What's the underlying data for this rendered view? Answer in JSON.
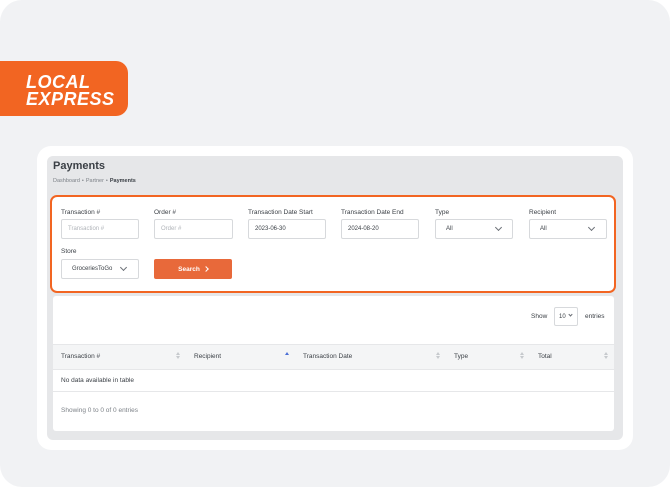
{
  "brand": {
    "logo_line1": "LOCAL",
    "logo_line2": "EXPRESS",
    "accent": "#f26522"
  },
  "page": {
    "title": "Payments",
    "breadcrumb": [
      "Dashboard",
      "Partner",
      "Payments"
    ],
    "separator": "•"
  },
  "filters": {
    "transaction": {
      "label": "Transaction #",
      "placeholder": "Transaction #",
      "value": ""
    },
    "order": {
      "label": "Order #",
      "placeholder": "Order #",
      "value": ""
    },
    "date_start": {
      "label": "Transaction Date Start",
      "value": "2023-06-30"
    },
    "date_end": {
      "label": "Transaction Date End",
      "value": "2024-08-20"
    },
    "type": {
      "label": "Type",
      "value": "All"
    },
    "recipient": {
      "label": "Recipient",
      "value": "All"
    },
    "store": {
      "label": "Store",
      "value": "GroceriesToGo"
    },
    "search_label": "Search"
  },
  "table": {
    "show_label": "Show",
    "page_size": "10",
    "entries_label": "entries",
    "columns": [
      "Transaction #",
      "Recipient",
      "Transaction Date",
      "Type",
      "Total"
    ],
    "empty_message": "No data available in table",
    "info": "Showing 0 to 0 of 0 entries"
  }
}
